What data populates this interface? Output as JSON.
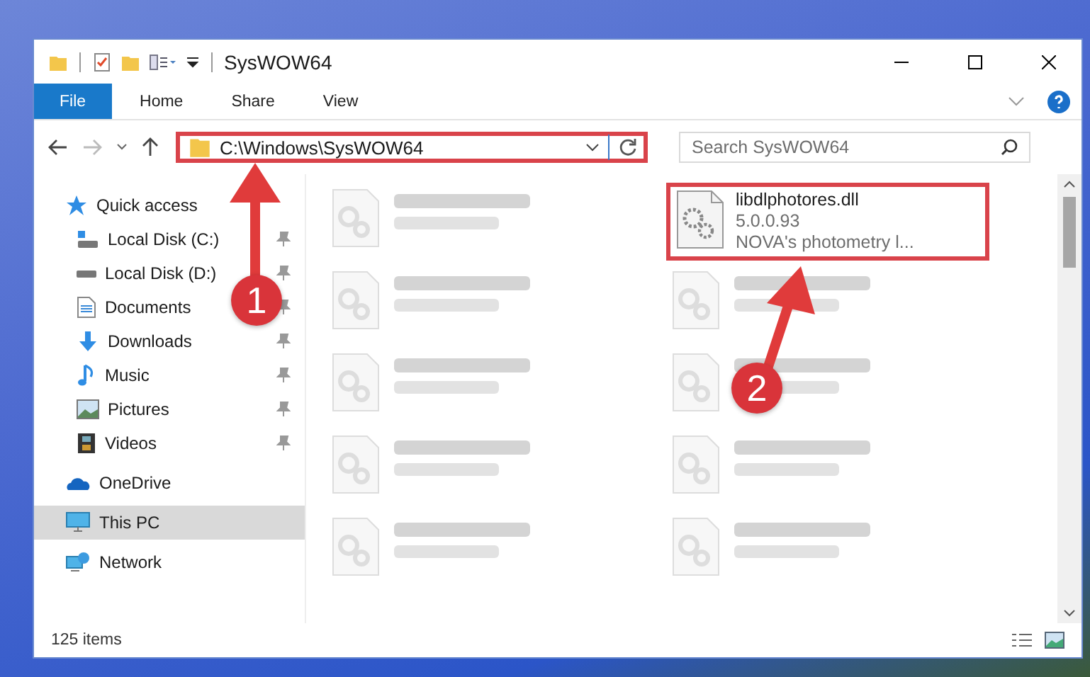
{
  "window": {
    "title": "SysWOW64"
  },
  "ribbon": {
    "tabs": [
      {
        "label": "File",
        "selected": true
      },
      {
        "label": "Home",
        "selected": false
      },
      {
        "label": "Share",
        "selected": false
      },
      {
        "label": "View",
        "selected": false
      }
    ]
  },
  "address": {
    "path": "C:\\Windows\\SysWOW64",
    "highlighted": true
  },
  "search": {
    "placeholder": "Search SysWOW64"
  },
  "sidebar": {
    "items": [
      {
        "label": "Quick access",
        "kind": "quick",
        "selected": false,
        "children": [
          {
            "label": "Local Disk (C:)",
            "kind": "diskc",
            "pinned": true
          },
          {
            "label": "Local Disk (D:)",
            "kind": "disk",
            "pinned": true
          },
          {
            "label": "Documents",
            "kind": "docs",
            "pinned": true
          },
          {
            "label": "Downloads",
            "kind": "down",
            "pinned": true
          },
          {
            "label": "Music",
            "kind": "music",
            "pinned": true
          },
          {
            "label": "Pictures",
            "kind": "pics",
            "pinned": true
          },
          {
            "label": "Videos",
            "kind": "videos",
            "pinned": true
          }
        ]
      },
      {
        "label": "OneDrive",
        "kind": "cloud",
        "selected": false
      },
      {
        "label": "This PC",
        "kind": "pc",
        "selected": true
      },
      {
        "label": "Network",
        "kind": "net",
        "selected": false
      }
    ]
  },
  "files": [
    {
      "kind": "blurred"
    },
    {
      "kind": "file",
      "name": "libdlphotores.dll",
      "line2": "5.0.0.93",
      "line3": "NOVA's photometry l...",
      "highlighted": true
    },
    {
      "kind": "blurred"
    },
    {
      "kind": "blurred"
    },
    {
      "kind": "blurred"
    },
    {
      "kind": "blurred"
    },
    {
      "kind": "blurred"
    },
    {
      "kind": "blurred"
    },
    {
      "kind": "blurred"
    },
    {
      "kind": "blurred"
    }
  ],
  "status_bar": {
    "count": "125 items"
  },
  "annotations": [
    {
      "number": "1"
    },
    {
      "number": "2"
    }
  ]
}
